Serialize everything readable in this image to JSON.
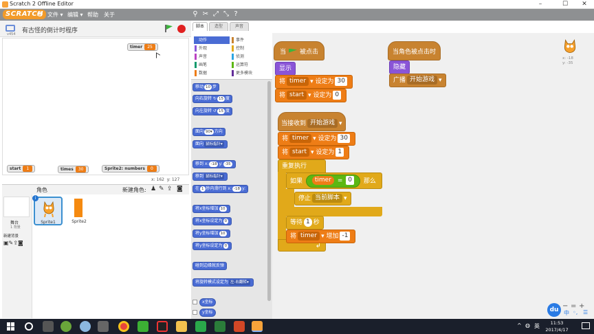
{
  "window": {
    "title": "Scratch 2 Offline Editor",
    "minimize": "–",
    "maximize": "☐",
    "close": "✕"
  },
  "menubar": {
    "logo": "SCRATCH",
    "items": [
      "文件 ▾",
      "编辑 ▾",
      "帮助",
      "关于"
    ],
    "tools": [
      "stamp-icon",
      "cut-icon",
      "grow-icon",
      "shrink-icon",
      "help-icon"
    ]
  },
  "stage": {
    "project_title": "有古怪的倒计时程序",
    "version": "v454",
    "monitors": [
      {
        "label": "timer",
        "value": "25"
      },
      {
        "label": "start",
        "value": "1"
      },
      {
        "label": "times",
        "value": "30"
      },
      {
        "label": "Sprite2: numbers",
        "value": "0"
      }
    ],
    "coords": {
      "x_label": "x:",
      "x": "162",
      "y_label": "y:",
      "y": "127"
    }
  },
  "sprites": {
    "header": "角色",
    "new_sprite": "新建角色:",
    "stage_label": "舞台",
    "stage_bg": "1 背景",
    "new_backdrop": "新建背景",
    "items": [
      {
        "name": "Sprite1"
      },
      {
        "name": "Sprite2"
      }
    ]
  },
  "tabs": [
    "脚本",
    "造型",
    "声音"
  ],
  "categories": [
    {
      "label": "动作",
      "color": "#4a6cd4"
    },
    {
      "label": "事件",
      "color": "#c88330"
    },
    {
      "label": "外观",
      "color": "#8a55d7"
    },
    {
      "label": "控制",
      "color": "#e1a91a"
    },
    {
      "label": "声音",
      "color": "#bb42c3"
    },
    {
      "label": "侦测",
      "color": "#2ca5e2"
    },
    {
      "label": "画笔",
      "color": "#0e9a6c"
    },
    {
      "label": "运算符",
      "color": "#5cb712"
    },
    {
      "label": "数据",
      "color": "#ee7d16"
    },
    {
      "label": "更多模块",
      "color": "#632d99"
    }
  ],
  "palette": {
    "move": [
      "移动",
      "10",
      "步"
    ],
    "turn_right": [
      "向右旋转",
      "15",
      "度"
    ],
    "turn_left": [
      "向左旋转",
      "15",
      "度"
    ],
    "point_dir": [
      "面向",
      "90▾",
      "方向"
    ],
    "point_towards": [
      "面向",
      "鼠标指针▾"
    ],
    "goto_xy": [
      "移到 x:",
      "-18",
      "y:",
      "-35"
    ],
    "goto": [
      "移到",
      "鼠标指针▾"
    ],
    "glide": [
      "在",
      "1",
      "秒内滑行到 x:",
      "-18",
      "y:"
    ],
    "change_x": [
      "将x坐标增加",
      "10"
    ],
    "set_x": [
      "将x坐标设定为",
      "0"
    ],
    "change_y": [
      "将y坐标增加",
      "10"
    ],
    "set_y": [
      "将y坐标设定为",
      "0"
    ],
    "bounce": "碰到边缘就反弹",
    "rotation": [
      "将旋转模式设定为",
      "左-右翻转▾"
    ],
    "x_rep": "x坐标",
    "y_rep": "y坐标"
  },
  "scripts": {
    "flag_hat": [
      "当",
      "被点击"
    ],
    "show": "显示",
    "set1": [
      "将",
      "timer",
      "设定为",
      "30"
    ],
    "set2": [
      "将",
      "start",
      "设定为",
      "0"
    ],
    "click_hat": "当角色被点击时",
    "hide": "隐藏",
    "broadcast": [
      "广播",
      "开始游戏"
    ],
    "recv_hat": [
      "当接收到",
      "开始游戏"
    ],
    "set3": [
      "将",
      "timer",
      "设定为",
      "30"
    ],
    "set4": [
      "将",
      "start",
      "设定为",
      "1"
    ],
    "forever": "重复执行",
    "if": [
      "如果",
      "timer",
      "=",
      "0",
      "那么"
    ],
    "stop": [
      "停止",
      "当前脚本"
    ],
    "wait": [
      "等待",
      "1",
      "秒"
    ],
    "change": [
      "将",
      "timer",
      "增加",
      "-1"
    ],
    "sprite_info": {
      "x": "x: -18",
      "y": "y: -35"
    }
  },
  "taskbar": {
    "time": "11:53",
    "date": "2017/4/17",
    "ime": "中",
    "lang": "英"
  }
}
